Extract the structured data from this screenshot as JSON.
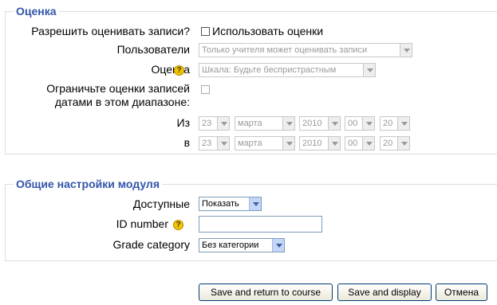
{
  "grading": {
    "legend": "Оценка",
    "allow_label": "Разрешить оценивать записи?",
    "use_grades_label": "Использовать оценки",
    "users_label": "Пользователи",
    "users_value": "Только учителя может оценивать записи",
    "grade_label": "Оценка",
    "grade_value": "Шкала: Будьте беспристрастным",
    "restrict_label_line1": "Ограничьте оценки записей",
    "restrict_label_line2": "датами в этом диапазоне:",
    "from_label": "Из",
    "to_label": "в",
    "from_date": {
      "day": "23",
      "month": "марта",
      "year": "2010",
      "hour": "00",
      "minute": "20"
    },
    "to_date": {
      "day": "23",
      "month": "марта",
      "year": "2010",
      "hour": "00",
      "minute": "20"
    }
  },
  "module": {
    "legend": "Общие настройки модуля",
    "visible_label": "Доступные",
    "visible_value": "Показать",
    "id_number_label": "ID number",
    "id_number_value": "",
    "grade_category_label": "Grade category",
    "grade_category_value": "Без категории"
  },
  "buttons": {
    "save_return": "Save and return to course",
    "save_display": "Save and display",
    "cancel": "Отмена"
  },
  "help_icon_glyph": "?",
  "colors": {
    "legend": "#3355aa",
    "help_icon": "#f3c300"
  }
}
